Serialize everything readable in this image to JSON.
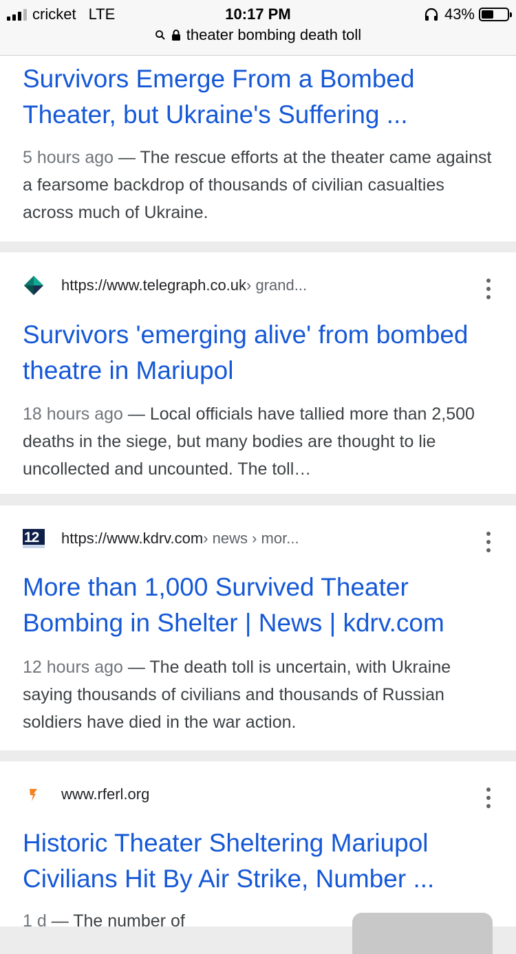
{
  "status": {
    "carrier": "cricket",
    "network": "LTE",
    "time": "10:17 PM",
    "battery": "43%",
    "battery_level": 0.43
  },
  "urlbar": {
    "query": "theater bombing death toll"
  },
  "results": [
    {
      "title": "Survivors Emerge From a Bombed Theater, but Ukraine's Suffering ...",
      "date": "5 hours ago",
      "snippet": "The rescue efforts at the theater came against a fearsome backdrop of thousands of civilian casualties across much of Ukraine."
    },
    {
      "url": "https://www.telegraph.co.uk",
      "path": " › grand...",
      "icon": "telegraph-favicon",
      "title": "Survivors 'emerging alive' from bombed theatre in Mariupol",
      "date": "18 hours ago",
      "snippet": "Local officials have tallied more than 2,500 deaths in the siege, but many bodies are thought to lie uncollected and uncounted. The toll…"
    },
    {
      "url": "https://www.kdrv.com",
      "path": " › news › mor...",
      "icon": "kdrv-favicon",
      "favicon_text": "12",
      "title": "More than 1,000 Survived Theater Bombing in Shelter | News | kdrv.com",
      "date": "12 hours ago",
      "snippet": "The death toll is uncertain, with Ukraine saying thousands of civilians and thousands of Russian soldiers have died in the war action."
    },
    {
      "url": "www.rferl.org",
      "path": "",
      "icon": "rferl-favicon",
      "title": "Historic Theater Sheltering Mariupol Civilians Hit By Air Strike, Number ...",
      "date": "1 d",
      "snippet": "The number of"
    }
  ],
  "separator": "—",
  "colors": {
    "link": "#1558d6",
    "snippet": "#3c4043",
    "date": "#70757a",
    "page_bg": "#ececec"
  }
}
